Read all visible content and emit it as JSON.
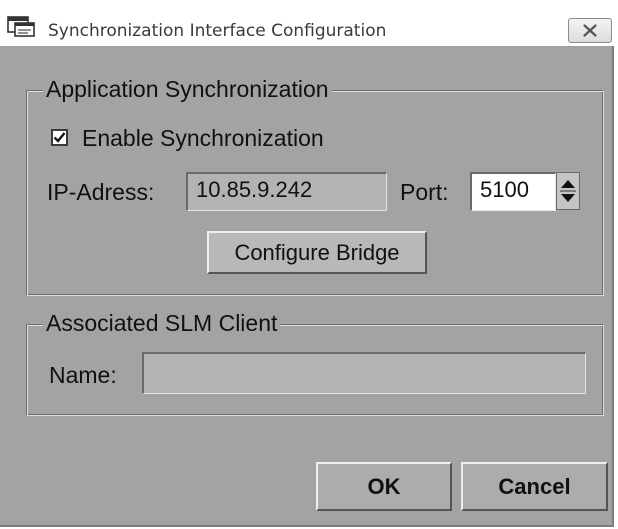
{
  "window": {
    "title": "Synchronization Interface Configuration",
    "app_icon": "app-window-icon",
    "close_icon": "close-x-icon"
  },
  "app_sync": {
    "title": "Application Synchronization",
    "enable_label": "Enable Synchronization",
    "enable_checked": true,
    "ip_label": "IP-Adress:",
    "ip_value": "10.85.9.242",
    "port_label": "Port:",
    "port_value": "5100",
    "configure_bridge_label": "Configure Bridge"
  },
  "slm_client": {
    "title": "Associated SLM Client",
    "name_label": "Name:",
    "name_value": ""
  },
  "footer": {
    "ok_label": "OK",
    "cancel_label": "Cancel"
  }
}
